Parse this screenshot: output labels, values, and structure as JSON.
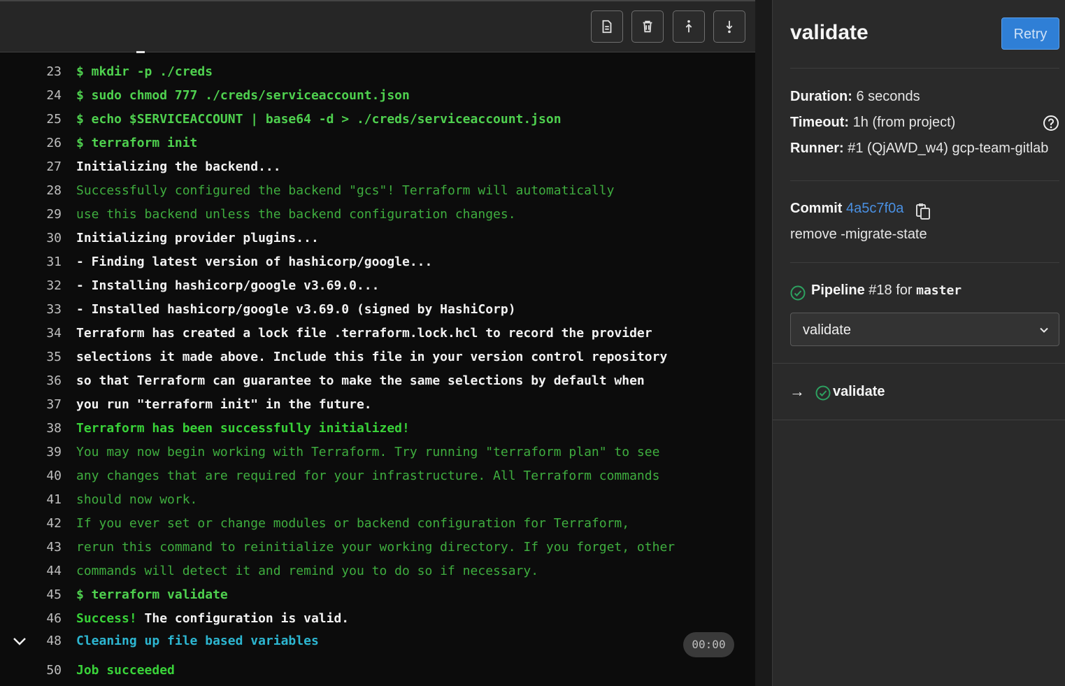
{
  "toolbar": {
    "buttons": [
      {
        "name": "show-raw-log",
        "icon": "file-icon"
      },
      {
        "name": "erase-log",
        "icon": "trash-icon"
      },
      {
        "name": "scroll-to-top",
        "icon": "scroll-up-icon"
      },
      {
        "name": "scroll-to-bottom",
        "icon": "scroll-down-icon"
      }
    ]
  },
  "log": {
    "lines": [
      {
        "n": "23",
        "text": "$ mkdir -p ./creds",
        "style": "cmd"
      },
      {
        "n": "24",
        "text": "$ sudo chmod 777 ./creds/serviceaccount.json",
        "style": "cmd"
      },
      {
        "n": "25",
        "text": "$ echo $SERVICEACCOUNT | base64 -d > ./creds/serviceaccount.json",
        "style": "cmd"
      },
      {
        "n": "26",
        "text": "$ terraform init",
        "style": "cmd"
      },
      {
        "n": "27",
        "text": "Initializing the backend...",
        "style": "white"
      },
      {
        "n": "28",
        "text": "Successfully configured the backend \"gcs\"! Terraform will automatically",
        "style": "green"
      },
      {
        "n": "29",
        "text": "use this backend unless the backend configuration changes.",
        "style": "green"
      },
      {
        "n": "30",
        "text": "Initializing provider plugins...",
        "style": "white"
      },
      {
        "n": "31",
        "text": "- Finding latest version of hashicorp/google...",
        "style": "white"
      },
      {
        "n": "32",
        "text": "- Installing hashicorp/google v3.69.0...",
        "style": "white"
      },
      {
        "n": "33",
        "text": "- Installed hashicorp/google v3.69.0 (signed by HashiCorp)",
        "style": "white"
      },
      {
        "n": "34",
        "text": "Terraform has created a lock file .terraform.lock.hcl to record the provider",
        "style": "white"
      },
      {
        "n": "35",
        "text": "selections it made above. Include this file in your version control repository",
        "style": "white"
      },
      {
        "n": "36",
        "text": "so that Terraform can guarantee to make the same selections by default when",
        "style": "white"
      },
      {
        "n": "37",
        "text": "you run \"terraform init\" in the future.",
        "style": "white"
      },
      {
        "n": "38",
        "text": "Terraform has been successfully initialized!",
        "style": "okbold"
      },
      {
        "n": "39",
        "text": "You may now begin working with Terraform. Try running \"terraform plan\" to see",
        "style": "green"
      },
      {
        "n": "40",
        "text": "any changes that are required for your infrastructure. All Terraform commands",
        "style": "green"
      },
      {
        "n": "41",
        "text": "should now work.",
        "style": "green"
      },
      {
        "n": "42",
        "text": "If you ever set or change modules or backend configuration for Terraform,",
        "style": "green"
      },
      {
        "n": "43",
        "text": "rerun this command to reinitialize your working directory. If you forget, other",
        "style": "green"
      },
      {
        "n": "44",
        "text": "commands will detect it and remind you to do so if necessary.",
        "style": "green"
      },
      {
        "n": "45",
        "text": "$ terraform validate",
        "style": "cmd"
      },
      {
        "n": "46",
        "text_parts": [
          {
            "text": "Success!",
            "style": "okbold"
          },
          {
            "text": " The configuration is valid.",
            "style": "white"
          }
        ]
      },
      {
        "n": "48",
        "text": "Cleaning up file based variables",
        "style": "cyan"
      },
      {
        "n": "50",
        "text": "Job succeeded",
        "style": "okbold"
      }
    ],
    "section_duration": "00:00"
  },
  "sidebar": {
    "title": "validate",
    "retry_label": "Retry",
    "duration_label": "Duration:",
    "duration_value": " 6 seconds",
    "timeout_label": "Timeout:",
    "timeout_value": " 1h (from project)",
    "runner_label": "Runner:",
    "runner_value": " #1 (QjAWD_w4) gcp-team-gitlab",
    "commit_label": "Commit",
    "commit_sha": "4a5c7f0a",
    "commit_message": "remove -migrate-state",
    "pipeline_label": "Pipeline",
    "pipeline_id": "#18",
    "pipeline_for": "for",
    "pipeline_branch": "master",
    "stage_selected": "validate",
    "job_name": "validate",
    "status_color": "#2da160",
    "accent_color": "#2f7fd6"
  }
}
